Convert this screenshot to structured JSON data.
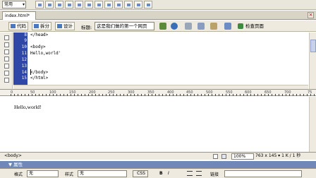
{
  "toolbar": {
    "insert_select": "常用"
  },
  "document": {
    "tab": "index.html*",
    "close": "×"
  },
  "view": {
    "code_label": "代码",
    "split_label": "拆分",
    "design_label": "设计",
    "title_label": "标题:",
    "title_value": "这是我们做的第一个网页",
    "check_page_label": "检查页面"
  },
  "code": {
    "line_numbers": [
      "8",
      "9",
      "10",
      "11",
      "12",
      "13",
      "14",
      "15"
    ],
    "lines": [
      "</head>",
      "",
      "<body>",
      "Hello,world'",
      "",
      "",
      "</body>",
      "</html>"
    ]
  },
  "ruler": {
    "ticks": [
      "0",
      "50",
      "100",
      "150",
      "200",
      "250",
      "300",
      "350",
      "400",
      "450",
      "500",
      "550",
      "600",
      "650",
      "700",
      "75"
    ]
  },
  "design": {
    "content": "Hello,world!"
  },
  "status": {
    "tag": "<body>",
    "zoom": "100%",
    "dimensions": "763 x 145 ▾ 1 K / 1 秒"
  },
  "properties": {
    "title": "▼ 属性",
    "format_label": "格式",
    "format_value": "无",
    "style_label": "样式",
    "style_value": "无",
    "css_label": "CSS",
    "link_label": "链接"
  }
}
